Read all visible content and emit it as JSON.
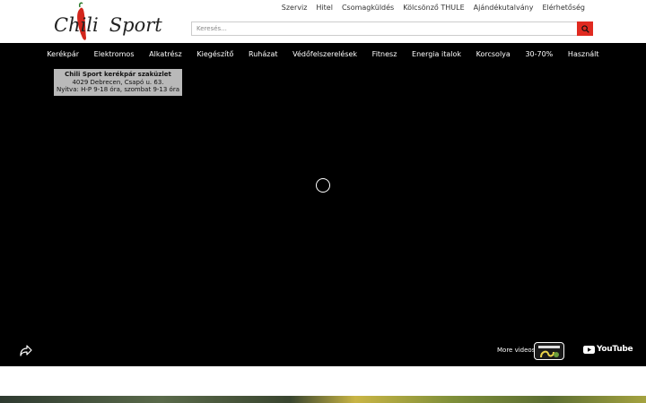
{
  "brand": {
    "logo_text_left": "Chili",
    "logo_text_right": "Sport",
    "pepper_color": "#d3261c"
  },
  "top_links": [
    "Szerviz",
    "Hitel",
    "Csomagküldés",
    "Kölcsönző THULE",
    "Ajándékutalvány",
    "Elérhetőség"
  ],
  "search": {
    "placeholder": "Keresés...",
    "button_icon": "search-icon",
    "button_color": "#e02a20"
  },
  "nav": [
    "Kerékpár",
    "Elektromos",
    "Alkatrész",
    "Kiegészítő",
    "Ruházat",
    "Védőfelszerelések",
    "Fitnesz",
    "Energia italok",
    "Korcsolya",
    "30-70%",
    "Használt"
  ],
  "video": {
    "store_title": "Chili Sport kerékpár szaküzlet",
    "store_address": "4029 Debrecen, Csapó u. 63.",
    "store_hours": "Nyitva: H-P 9-18 óra, szombat 9-13 óra",
    "more_videos": "More videos",
    "youtube_label": "YouTube",
    "share_icon": "share-icon",
    "spinner_icon": "loading-spinner-icon"
  }
}
